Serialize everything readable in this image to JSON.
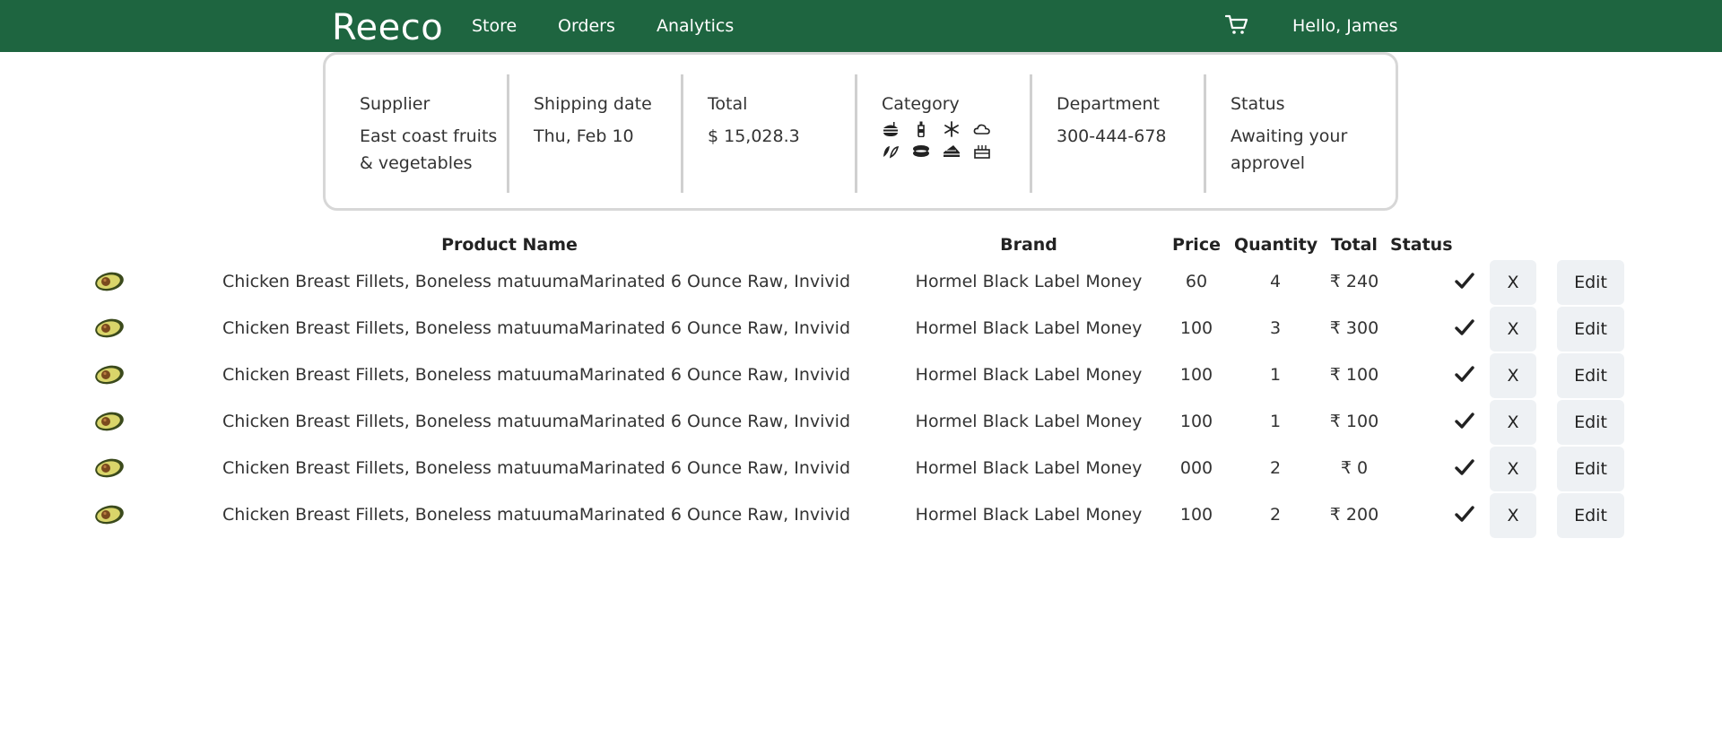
{
  "nav": {
    "brand": "Reeco",
    "links": [
      "Store",
      "Orders",
      "Analytics"
    ],
    "greeting": "Hello, James"
  },
  "summary": {
    "supplier_label": "Supplier",
    "supplier_value_line1": "East coast fruits",
    "supplier_value_line2": "& vegetables",
    "shipping_label": "Shipping date",
    "shipping_value": "Thu, Feb 10",
    "total_label": "Total",
    "total_value": "$ 15,028.3",
    "category_label": "Category",
    "category_icons": [
      "burger-fries-icon",
      "bottle-icon",
      "snowflake-icon",
      "cloud-icon",
      "leaf-icon",
      "fish-icon",
      "cake-slice-icon",
      "birthday-cake-icon"
    ],
    "department_label": "Department",
    "department_value": "300-444-678",
    "status_label": "Status",
    "status_value_line1": "Awaiting your",
    "status_value_line2": "approvel"
  },
  "table": {
    "headers": {
      "product": "Product Name",
      "brand": "Brand",
      "price": "Price",
      "quantity": "Quantity",
      "total": "Total",
      "status": "Status"
    },
    "x_label": "X",
    "edit_label": "Edit",
    "rows": [
      {
        "product": "Chicken Breast Fillets, Boneless matuumaMarinated 6 Ounce Raw, Invivid",
        "brand": "Hormel Black Label Money",
        "price": "60",
        "quantity": "4",
        "total": "₹ 240"
      },
      {
        "product": "Chicken Breast Fillets, Boneless matuumaMarinated 6 Ounce Raw, Invivid",
        "brand": "Hormel Black Label Money",
        "price": "100",
        "quantity": "3",
        "total": "₹ 300"
      },
      {
        "product": "Chicken Breast Fillets, Boneless matuumaMarinated 6 Ounce Raw, Invivid",
        "brand": "Hormel Black Label Money",
        "price": "100",
        "quantity": "1",
        "total": "₹ 100"
      },
      {
        "product": "Chicken Breast Fillets, Boneless matuumaMarinated 6 Ounce Raw, Invivid",
        "brand": "Hormel Black Label Money",
        "price": "100",
        "quantity": "1",
        "total": "₹ 100"
      },
      {
        "product": "Chicken Breast Fillets, Boneless matuumaMarinated 6 Ounce Raw, Invivid",
        "brand": "Hormel Black Label Money",
        "price": "000",
        "quantity": "2",
        "total": "₹ 0"
      },
      {
        "product": "Chicken Breast Fillets, Boneless matuumaMarinated 6 Ounce Raw, Invivid",
        "brand": "Hormel Black Label Money",
        "price": "100",
        "quantity": "2",
        "total": "₹ 200"
      }
    ]
  },
  "colors": {
    "nav_bg": "#1e6540",
    "button_bg": "#eef1f4"
  }
}
